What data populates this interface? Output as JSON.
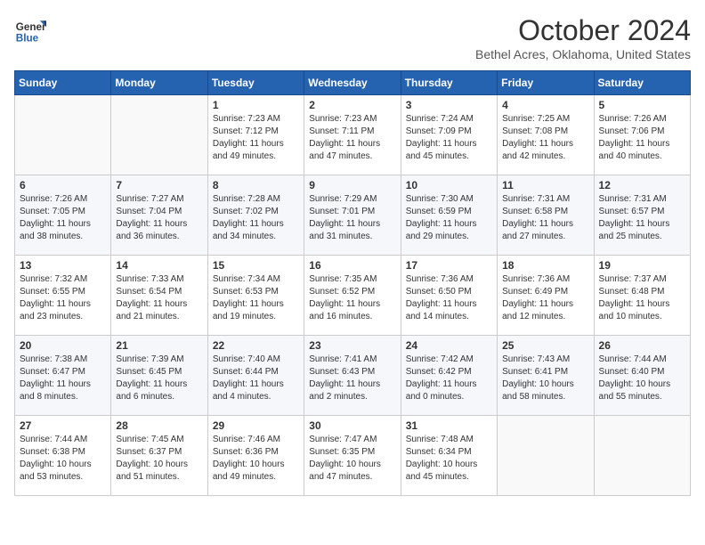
{
  "header": {
    "logo_line1": "General",
    "logo_line2": "Blue",
    "month": "October 2024",
    "location": "Bethel Acres, Oklahoma, United States"
  },
  "weekdays": [
    "Sunday",
    "Monday",
    "Tuesday",
    "Wednesday",
    "Thursday",
    "Friday",
    "Saturday"
  ],
  "weeks": [
    [
      {
        "day": "",
        "info": ""
      },
      {
        "day": "",
        "info": ""
      },
      {
        "day": "1",
        "info": "Sunrise: 7:23 AM\nSunset: 7:12 PM\nDaylight: 11 hours and 49 minutes."
      },
      {
        "day": "2",
        "info": "Sunrise: 7:23 AM\nSunset: 7:11 PM\nDaylight: 11 hours and 47 minutes."
      },
      {
        "day": "3",
        "info": "Sunrise: 7:24 AM\nSunset: 7:09 PM\nDaylight: 11 hours and 45 minutes."
      },
      {
        "day": "4",
        "info": "Sunrise: 7:25 AM\nSunset: 7:08 PM\nDaylight: 11 hours and 42 minutes."
      },
      {
        "day": "5",
        "info": "Sunrise: 7:26 AM\nSunset: 7:06 PM\nDaylight: 11 hours and 40 minutes."
      }
    ],
    [
      {
        "day": "6",
        "info": "Sunrise: 7:26 AM\nSunset: 7:05 PM\nDaylight: 11 hours and 38 minutes."
      },
      {
        "day": "7",
        "info": "Sunrise: 7:27 AM\nSunset: 7:04 PM\nDaylight: 11 hours and 36 minutes."
      },
      {
        "day": "8",
        "info": "Sunrise: 7:28 AM\nSunset: 7:02 PM\nDaylight: 11 hours and 34 minutes."
      },
      {
        "day": "9",
        "info": "Sunrise: 7:29 AM\nSunset: 7:01 PM\nDaylight: 11 hours and 31 minutes."
      },
      {
        "day": "10",
        "info": "Sunrise: 7:30 AM\nSunset: 6:59 PM\nDaylight: 11 hours and 29 minutes."
      },
      {
        "day": "11",
        "info": "Sunrise: 7:31 AM\nSunset: 6:58 PM\nDaylight: 11 hours and 27 minutes."
      },
      {
        "day": "12",
        "info": "Sunrise: 7:31 AM\nSunset: 6:57 PM\nDaylight: 11 hours and 25 minutes."
      }
    ],
    [
      {
        "day": "13",
        "info": "Sunrise: 7:32 AM\nSunset: 6:55 PM\nDaylight: 11 hours and 23 minutes."
      },
      {
        "day": "14",
        "info": "Sunrise: 7:33 AM\nSunset: 6:54 PM\nDaylight: 11 hours and 21 minutes."
      },
      {
        "day": "15",
        "info": "Sunrise: 7:34 AM\nSunset: 6:53 PM\nDaylight: 11 hours and 19 minutes."
      },
      {
        "day": "16",
        "info": "Sunrise: 7:35 AM\nSunset: 6:52 PM\nDaylight: 11 hours and 16 minutes."
      },
      {
        "day": "17",
        "info": "Sunrise: 7:36 AM\nSunset: 6:50 PM\nDaylight: 11 hours and 14 minutes."
      },
      {
        "day": "18",
        "info": "Sunrise: 7:36 AM\nSunset: 6:49 PM\nDaylight: 11 hours and 12 minutes."
      },
      {
        "day": "19",
        "info": "Sunrise: 7:37 AM\nSunset: 6:48 PM\nDaylight: 11 hours and 10 minutes."
      }
    ],
    [
      {
        "day": "20",
        "info": "Sunrise: 7:38 AM\nSunset: 6:47 PM\nDaylight: 11 hours and 8 minutes."
      },
      {
        "day": "21",
        "info": "Sunrise: 7:39 AM\nSunset: 6:45 PM\nDaylight: 11 hours and 6 minutes."
      },
      {
        "day": "22",
        "info": "Sunrise: 7:40 AM\nSunset: 6:44 PM\nDaylight: 11 hours and 4 minutes."
      },
      {
        "day": "23",
        "info": "Sunrise: 7:41 AM\nSunset: 6:43 PM\nDaylight: 11 hours and 2 minutes."
      },
      {
        "day": "24",
        "info": "Sunrise: 7:42 AM\nSunset: 6:42 PM\nDaylight: 11 hours and 0 minutes."
      },
      {
        "day": "25",
        "info": "Sunrise: 7:43 AM\nSunset: 6:41 PM\nDaylight: 10 hours and 58 minutes."
      },
      {
        "day": "26",
        "info": "Sunrise: 7:44 AM\nSunset: 6:40 PM\nDaylight: 10 hours and 55 minutes."
      }
    ],
    [
      {
        "day": "27",
        "info": "Sunrise: 7:44 AM\nSunset: 6:38 PM\nDaylight: 10 hours and 53 minutes."
      },
      {
        "day": "28",
        "info": "Sunrise: 7:45 AM\nSunset: 6:37 PM\nDaylight: 10 hours and 51 minutes."
      },
      {
        "day": "29",
        "info": "Sunrise: 7:46 AM\nSunset: 6:36 PM\nDaylight: 10 hours and 49 minutes."
      },
      {
        "day": "30",
        "info": "Sunrise: 7:47 AM\nSunset: 6:35 PM\nDaylight: 10 hours and 47 minutes."
      },
      {
        "day": "31",
        "info": "Sunrise: 7:48 AM\nSunset: 6:34 PM\nDaylight: 10 hours and 45 minutes."
      },
      {
        "day": "",
        "info": ""
      },
      {
        "day": "",
        "info": ""
      }
    ]
  ]
}
